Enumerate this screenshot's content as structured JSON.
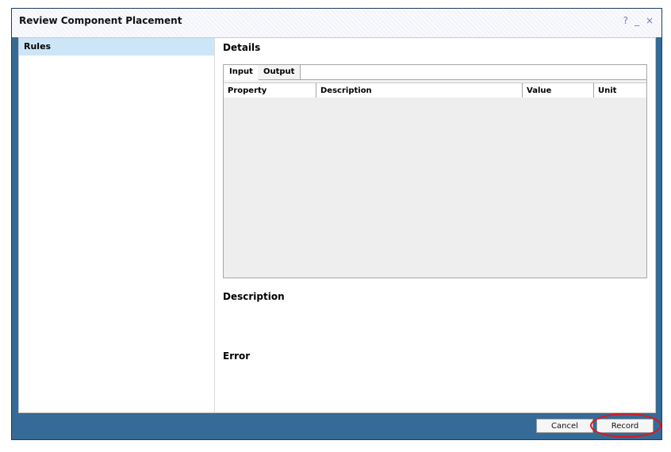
{
  "window": {
    "title": "Review Component Placement",
    "controls": {
      "help": "?",
      "minimize": "_",
      "close": "×"
    }
  },
  "sidebar": {
    "items": [
      {
        "label": "Rules"
      }
    ]
  },
  "details": {
    "label": "Details",
    "tabs": [
      {
        "label": "Input",
        "active": true
      },
      {
        "label": "Output",
        "active": false
      }
    ],
    "columns": [
      "Property",
      "Description",
      "Value",
      "Unit"
    ],
    "rows": []
  },
  "description": {
    "label": "Description"
  },
  "error": {
    "label": "Error"
  },
  "buttons": {
    "cancel": "Cancel",
    "record": "Record"
  },
  "colors": {
    "frame": "#356b96",
    "selection": "#cde6f7",
    "highlight": "#e0151d"
  }
}
